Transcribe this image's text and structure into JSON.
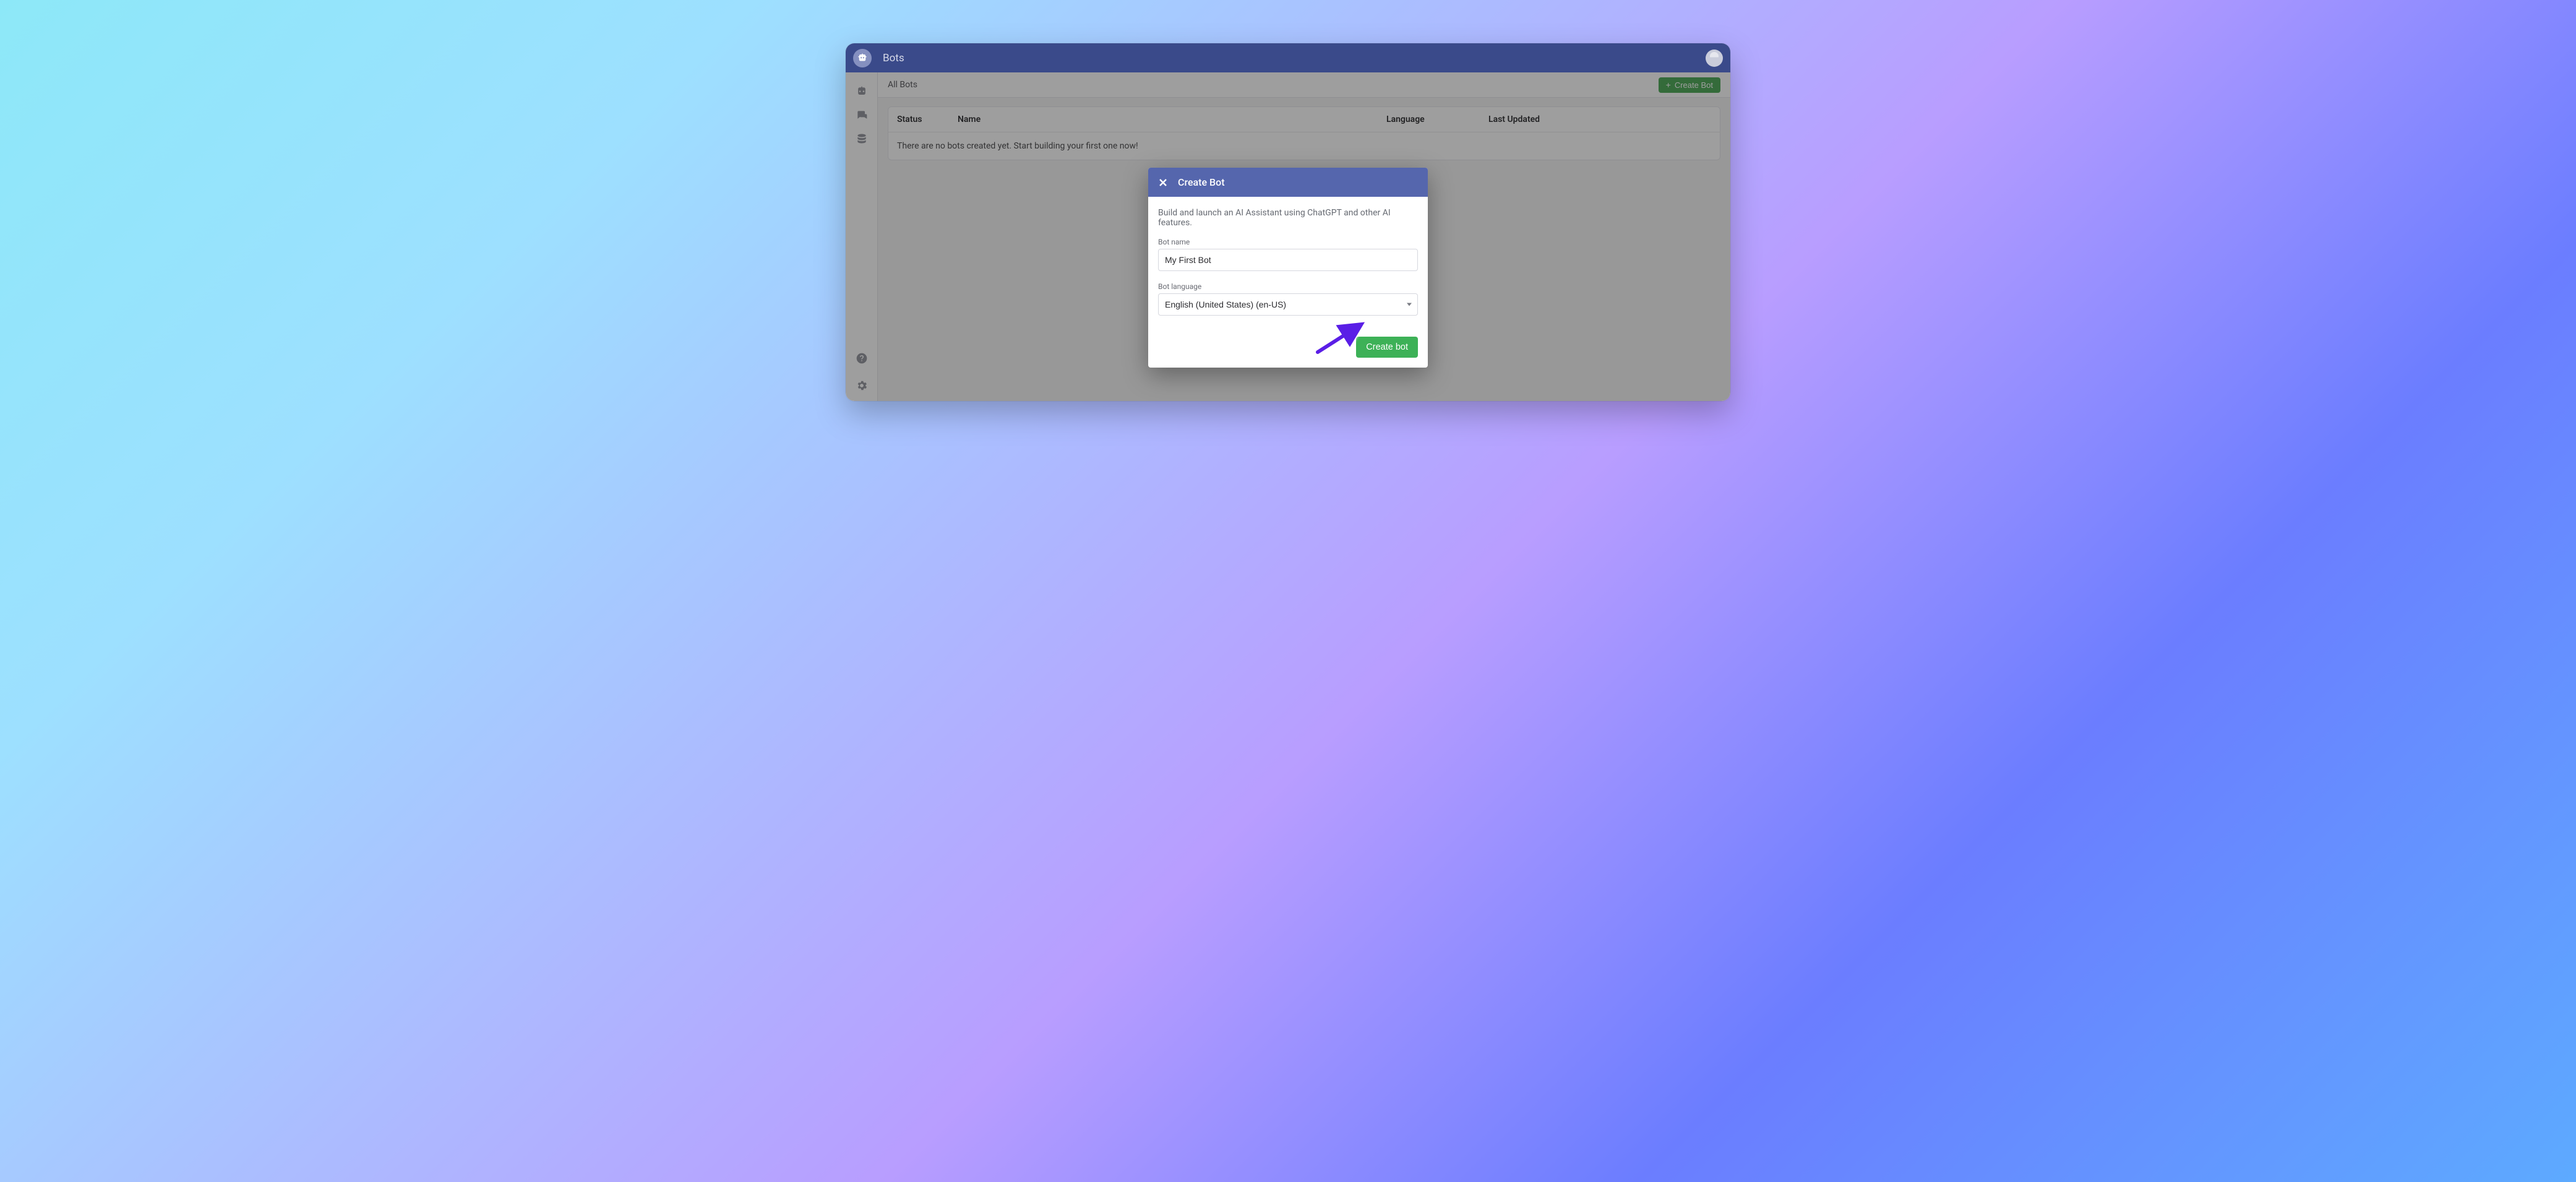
{
  "header": {
    "title": "Bots"
  },
  "sidebar": {
    "items": [
      {
        "name": "bots-icon"
      },
      {
        "name": "conversations-icon"
      },
      {
        "name": "data-icon"
      }
    ],
    "bottom": [
      {
        "name": "help-icon"
      },
      {
        "name": "settings-icon"
      }
    ]
  },
  "toolbar": {
    "title": "All Bots",
    "create_label": "Create Bot"
  },
  "table": {
    "columns": {
      "status": "Status",
      "name": "Name",
      "language": "Language",
      "last_updated": "Last Updated"
    },
    "empty_message": "There are no bots created yet. Start building your first one now!"
  },
  "modal": {
    "title": "Create Bot",
    "description": "Build and launch an AI Assistant using ChatGPT and other AI features.",
    "bot_name_label": "Bot name",
    "bot_name_value": "My First Bot",
    "bot_language_label": "Bot language",
    "bot_language_value": "English (United States) (en-US)",
    "submit_label": "Create bot"
  }
}
